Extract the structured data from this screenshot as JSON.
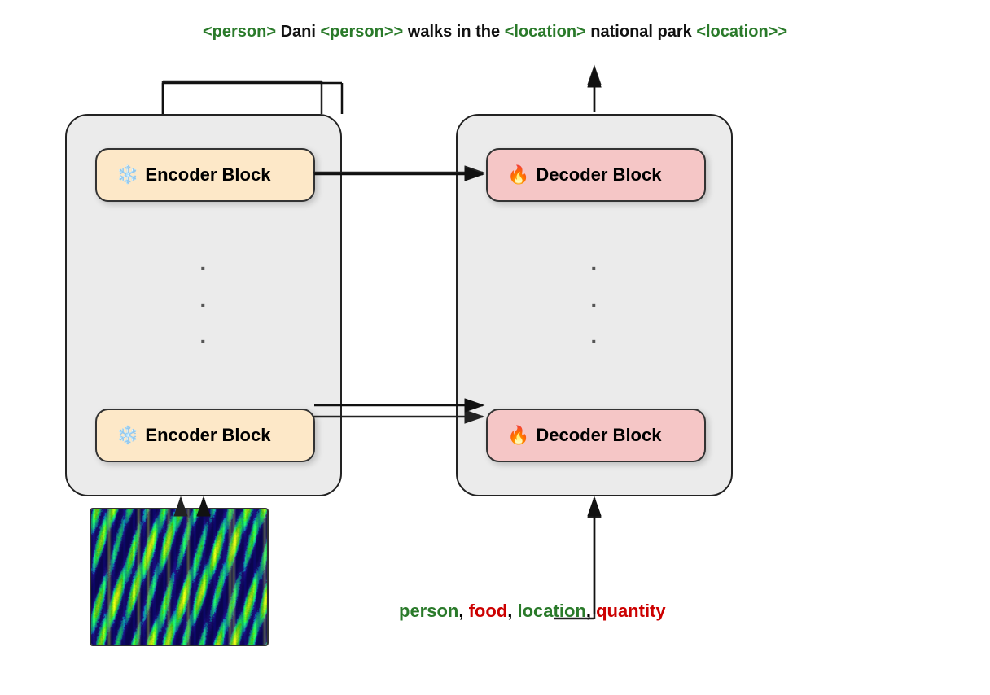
{
  "output": {
    "parts": [
      {
        "text": "<",
        "color": "green"
      },
      {
        "text": "person",
        "color": "green"
      },
      {
        "text": "> Dani <",
        "color": "green"
      },
      {
        "text": "person",
        "color": "green"
      },
      {
        "text": ">> walks in the <",
        "color": "black"
      },
      {
        "text": "location",
        "color": "green"
      },
      {
        "text": "> national park <",
        "color": "green"
      },
      {
        "text": "location",
        "color": "green"
      },
      {
        "text": ">>",
        "color": "green"
      }
    ],
    "full_text": "<person> Dani <person>> walks in the <location> national park <location>>"
  },
  "encoder": {
    "label": "Encoder Block",
    "icon": "❄️",
    "dots": "·\n·\n·"
  },
  "decoder": {
    "label": "Decoder Block",
    "icon": "🔥",
    "dots": "·\n·\n·"
  },
  "entity_tags": {
    "items": [
      {
        "text": "person",
        "color": "green"
      },
      {
        "text": ", ",
        "color": "black"
      },
      {
        "text": "food",
        "color": "red"
      },
      {
        "text": ", ",
        "color": "black"
      },
      {
        "text": "location",
        "color": "green"
      },
      {
        "text": ", ",
        "color": "black"
      },
      {
        "text": "quantity",
        "color": "red"
      }
    ]
  },
  "arrows": {
    "description": "arrows connecting encoder to decoder and inputs to outputs"
  }
}
